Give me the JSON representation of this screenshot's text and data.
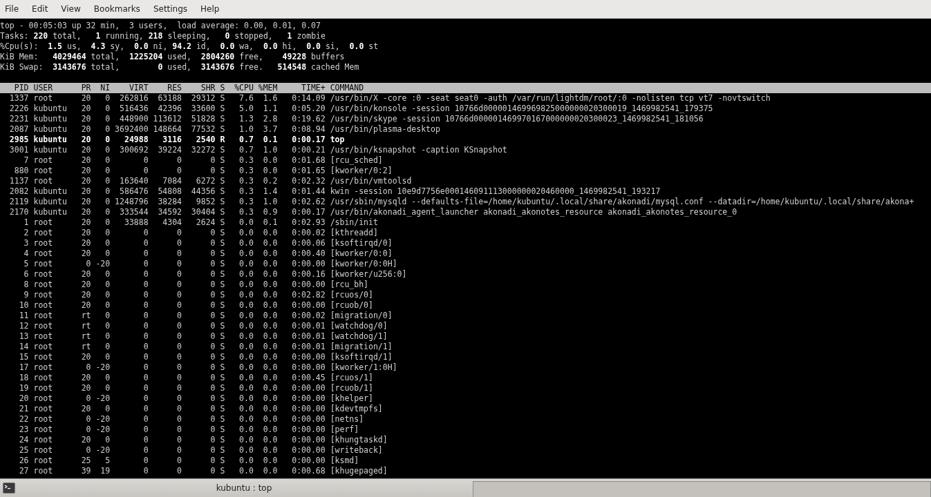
{
  "menu": [
    "File",
    "Edit",
    "View",
    "Bookmarks",
    "Settings",
    "Help"
  ],
  "summary": [
    "top - 00:05:03 up 32 min,  3 users,  load average: 0.00, 0.01, 0.07",
    "Tasks: **220** total,   **1** running, **218** sleeping,   **0** stopped,   **1** zombie",
    "%Cpu(s):  **1.5** us,  **4.3** sy,  **0.0** ni, **94.2** id,  **0.0** wa,  **0.0** hi,  **0.0** si,  **0.0** st",
    "KiB Mem:   **4029464** total,  **1225204** used,  **2804260** free,    **49228** buffers",
    "KiB Swap:  **3143676** total,        **0** used,  **3143676** free.   **514548** cached Mem"
  ],
  "table": {
    "columns": [
      "PID",
      "USER",
      "PR",
      "NI",
      "VIRT",
      "RES",
      "SHR",
      "S",
      "%CPU",
      "%MEM",
      "TIME+",
      "COMMAND"
    ],
    "rows": [
      {
        "cells": [
          "1337",
          "root",
          "20",
          "0",
          "262816",
          "63188",
          "29312",
          "S",
          "7.6",
          "1.6",
          "0:14.09",
          "/usr/bin/X -core :0 -seat seat0 -auth /var/run/lightdm/root/:0 -nolisten tcp vt7 -novtswitch"
        ],
        "highlighted": false
      },
      {
        "cells": [
          "2226",
          "kubuntu",
          "20",
          "0",
          "516436",
          "42396",
          "33600",
          "S",
          "5.0",
          "1.1",
          "0:05.20",
          "/usr/bin/konsole -session 10766d000001469969825000000020300019_1469982541_179375"
        ],
        "highlighted": false
      },
      {
        "cells": [
          "2231",
          "kubuntu",
          "20",
          "0",
          "448900",
          "113612",
          "51828",
          "S",
          "1.3",
          "2.8",
          "0:19.62",
          "/usr/bin/skype -session 10766d000001469970167000000020300023_1469982541_181056"
        ],
        "highlighted": false
      },
      {
        "cells": [
          "2087",
          "kubuntu",
          "20",
          "0",
          "3692400",
          "148664",
          "77532",
          "S",
          "1.0",
          "3.7",
          "0:08.94",
          "/usr/bin/plasma-desktop"
        ],
        "highlighted": false
      },
      {
        "cells": [
          "2985",
          "kubuntu",
          "20",
          "0",
          "24988",
          "3116",
          "2540",
          "R",
          "0.7",
          "0.1",
          "0:00.17",
          "top"
        ],
        "highlighted": true
      },
      {
        "cells": [
          "3001",
          "kubuntu",
          "20",
          "0",
          "300692",
          "39224",
          "32272",
          "S",
          "0.7",
          "1.0",
          "0:00.21",
          "/usr/bin/ksnapshot -caption KSnapshot"
        ],
        "highlighted": false
      },
      {
        "cells": [
          "7",
          "root",
          "20",
          "0",
          "0",
          "0",
          "0",
          "S",
          "0.3",
          "0.0",
          "0:01.68",
          "[rcu_sched]"
        ],
        "highlighted": false
      },
      {
        "cells": [
          "880",
          "root",
          "20",
          "0",
          "0",
          "0",
          "0",
          "S",
          "0.3",
          "0.0",
          "0:01.65",
          "[kworker/0:2]"
        ],
        "highlighted": false
      },
      {
        "cells": [
          "1137",
          "root",
          "20",
          "0",
          "163640",
          "7084",
          "6272",
          "S",
          "0.3",
          "0.2",
          "0:02.32",
          "/usr/bin/vmtoolsd"
        ],
        "highlighted": false
      },
      {
        "cells": [
          "2082",
          "kubuntu",
          "20",
          "0",
          "586476",
          "54808",
          "44356",
          "S",
          "0.3",
          "1.4",
          "0:01.44",
          "kwin -session 10e9d7756e000146091113000000020460000_1469982541_193217"
        ],
        "highlighted": false
      },
      {
        "cells": [
          "2119",
          "kubuntu",
          "20",
          "0",
          "1248796",
          "38284",
          "9852",
          "S",
          "0.3",
          "1.0",
          "0:02.62",
          "/usr/sbin/mysqld --defaults-file=/home/kubuntu/.local/share/akonadi/mysql.conf --datadir=/home/kubuntu/.local/share/akona+"
        ],
        "highlighted": false
      },
      {
        "cells": [
          "2170",
          "kubuntu",
          "20",
          "0",
          "333544",
          "34592",
          "30404",
          "S",
          "0.3",
          "0.9",
          "0:00.17",
          "/usr/bin/akonadi_agent_launcher akonadi_akonotes_resource akonadi_akonotes_resource_0"
        ],
        "highlighted": false
      },
      {
        "cells": [
          "1",
          "root",
          "20",
          "0",
          "33888",
          "4304",
          "2624",
          "S",
          "0.0",
          "0.1",
          "0:02.93",
          "/sbin/init"
        ],
        "highlighted": false
      },
      {
        "cells": [
          "2",
          "root",
          "20",
          "0",
          "0",
          "0",
          "0",
          "S",
          "0.0",
          "0.0",
          "0:00.02",
          "[kthreadd]"
        ],
        "highlighted": false
      },
      {
        "cells": [
          "3",
          "root",
          "20",
          "0",
          "0",
          "0",
          "0",
          "S",
          "0.0",
          "0.0",
          "0:00.06",
          "[ksoftirqd/0]"
        ],
        "highlighted": false
      },
      {
        "cells": [
          "4",
          "root",
          "20",
          "0",
          "0",
          "0",
          "0",
          "S",
          "0.0",
          "0.0",
          "0:00.40",
          "[kworker/0:0]"
        ],
        "highlighted": false
      },
      {
        "cells": [
          "5",
          "root",
          "0",
          "-20",
          "0",
          "0",
          "0",
          "S",
          "0.0",
          "0.0",
          "0:00.00",
          "[kworker/0:0H]"
        ],
        "highlighted": false
      },
      {
        "cells": [
          "6",
          "root",
          "20",
          "0",
          "0",
          "0",
          "0",
          "S",
          "0.0",
          "0.0",
          "0:00.16",
          "[kworker/u256:0]"
        ],
        "highlighted": false
      },
      {
        "cells": [
          "8",
          "root",
          "20",
          "0",
          "0",
          "0",
          "0",
          "S",
          "0.0",
          "0.0",
          "0:00.00",
          "[rcu_bh]"
        ],
        "highlighted": false
      },
      {
        "cells": [
          "9",
          "root",
          "20",
          "0",
          "0",
          "0",
          "0",
          "S",
          "0.0",
          "0.0",
          "0:02.82",
          "[rcuos/0]"
        ],
        "highlighted": false
      },
      {
        "cells": [
          "10",
          "root",
          "20",
          "0",
          "0",
          "0",
          "0",
          "S",
          "0.0",
          "0.0",
          "0:00.00",
          "[rcuob/0]"
        ],
        "highlighted": false
      },
      {
        "cells": [
          "11",
          "root",
          "rt",
          "0",
          "0",
          "0",
          "0",
          "S",
          "0.0",
          "0.0",
          "0:00.02",
          "[migration/0]"
        ],
        "highlighted": false
      },
      {
        "cells": [
          "12",
          "root",
          "rt",
          "0",
          "0",
          "0",
          "0",
          "S",
          "0.0",
          "0.0",
          "0:00.01",
          "[watchdog/0]"
        ],
        "highlighted": false
      },
      {
        "cells": [
          "13",
          "root",
          "rt",
          "0",
          "0",
          "0",
          "0",
          "S",
          "0.0",
          "0.0",
          "0:00.01",
          "[watchdog/1]"
        ],
        "highlighted": false
      },
      {
        "cells": [
          "14",
          "root",
          "rt",
          "0",
          "0",
          "0",
          "0",
          "S",
          "0.0",
          "0.0",
          "0:00.01",
          "[migration/1]"
        ],
        "highlighted": false
      },
      {
        "cells": [
          "15",
          "root",
          "20",
          "0",
          "0",
          "0",
          "0",
          "S",
          "0.0",
          "0.0",
          "0:00.00",
          "[ksoftirqd/1]"
        ],
        "highlighted": false
      },
      {
        "cells": [
          "17",
          "root",
          "0",
          "-20",
          "0",
          "0",
          "0",
          "S",
          "0.0",
          "0.0",
          "0:00.00",
          "[kworker/1:0H]"
        ],
        "highlighted": false
      },
      {
        "cells": [
          "18",
          "root",
          "20",
          "0",
          "0",
          "0",
          "0",
          "S",
          "0.0",
          "0.0",
          "0:00.45",
          "[rcuos/1]"
        ],
        "highlighted": false
      },
      {
        "cells": [
          "19",
          "root",
          "20",
          "0",
          "0",
          "0",
          "0",
          "S",
          "0.0",
          "0.0",
          "0:00.00",
          "[rcuob/1]"
        ],
        "highlighted": false
      },
      {
        "cells": [
          "20",
          "root",
          "0",
          "-20",
          "0",
          "0",
          "0",
          "S",
          "0.0",
          "0.0",
          "0:00.00",
          "[khelper]"
        ],
        "highlighted": false
      },
      {
        "cells": [
          "21",
          "root",
          "20",
          "0",
          "0",
          "0",
          "0",
          "S",
          "0.0",
          "0.0",
          "0:00.00",
          "[kdevtmpfs]"
        ],
        "highlighted": false
      },
      {
        "cells": [
          "22",
          "root",
          "0",
          "-20",
          "0",
          "0",
          "0",
          "S",
          "0.0",
          "0.0",
          "0:00.00",
          "[netns]"
        ],
        "highlighted": false
      },
      {
        "cells": [
          "23",
          "root",
          "0",
          "-20",
          "0",
          "0",
          "0",
          "S",
          "0.0",
          "0.0",
          "0:00.00",
          "[perf]"
        ],
        "highlighted": false
      },
      {
        "cells": [
          "24",
          "root",
          "20",
          "0",
          "0",
          "0",
          "0",
          "S",
          "0.0",
          "0.0",
          "0:00.00",
          "[khungtaskd]"
        ],
        "highlighted": false
      },
      {
        "cells": [
          "25",
          "root",
          "0",
          "-20",
          "0",
          "0",
          "0",
          "S",
          "0.0",
          "0.0",
          "0:00.00",
          "[writeback]"
        ],
        "highlighted": false
      },
      {
        "cells": [
          "26",
          "root",
          "25",
          "5",
          "0",
          "0",
          "0",
          "S",
          "0.0",
          "0.0",
          "0:00.00",
          "[ksmd]"
        ],
        "highlighted": false
      },
      {
        "cells": [
          "27",
          "root",
          "39",
          "19",
          "0",
          "0",
          "0",
          "S",
          "0.0",
          "0.0",
          "0:00.68",
          "[khugepaged]"
        ],
        "highlighted": false
      }
    ]
  },
  "tab_bar": {
    "tab": "kubuntu : top"
  }
}
